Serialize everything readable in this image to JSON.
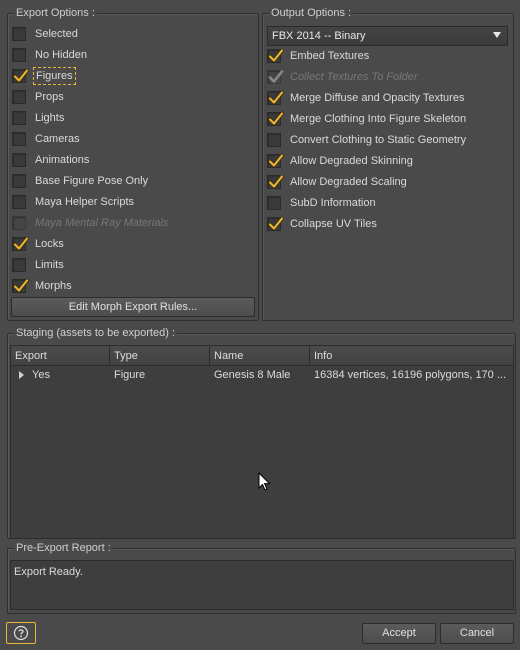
{
  "export_options": {
    "title": "Export Options :",
    "items": [
      {
        "label": "Selected",
        "checked": false,
        "disabled": false
      },
      {
        "label": "No Hidden",
        "checked": false,
        "disabled": false
      },
      {
        "label": "Figures",
        "checked": true,
        "disabled": false
      },
      {
        "label": "Props",
        "checked": false,
        "disabled": false
      },
      {
        "label": "Lights",
        "checked": false,
        "disabled": false
      },
      {
        "label": "Cameras",
        "checked": false,
        "disabled": false
      },
      {
        "label": "Animations",
        "checked": false,
        "disabled": false
      },
      {
        "label": "Base Figure Pose Only",
        "checked": false,
        "disabled": false
      },
      {
        "label": "Maya Helper Scripts",
        "checked": false,
        "disabled": false
      },
      {
        "label": "Maya Mental Ray Materials",
        "checked": false,
        "disabled": true
      },
      {
        "label": "Locks",
        "checked": true,
        "disabled": false
      },
      {
        "label": "Limits",
        "checked": false,
        "disabled": false
      },
      {
        "label": "Morphs",
        "checked": true,
        "disabled": false
      }
    ],
    "edit_morph_button": "Edit Morph Export Rules..."
  },
  "output_options": {
    "title": "Output Options :",
    "format_selected": "FBX 2014 -- Binary",
    "items": [
      {
        "label": "Embed Textures",
        "checked": true,
        "disabled": false
      },
      {
        "label": "Collect Textures To Folder",
        "checked": true,
        "disabled": true
      },
      {
        "label": "Merge Diffuse and Opacity Textures",
        "checked": true,
        "disabled": false
      },
      {
        "label": "Merge Clothing Into Figure Skeleton",
        "checked": true,
        "disabled": false
      },
      {
        "label": "Convert Clothing to Static Geometry",
        "checked": false,
        "disabled": false
      },
      {
        "label": "Allow Degraded Skinning",
        "checked": true,
        "disabled": false
      },
      {
        "label": "Allow Degraded Scaling",
        "checked": true,
        "disabled": false
      },
      {
        "label": "SubD Information",
        "checked": false,
        "disabled": false
      },
      {
        "label": "Collapse UV Tiles",
        "checked": true,
        "disabled": false
      }
    ]
  },
  "staging": {
    "title": "Staging (assets to be exported) :",
    "columns": [
      "Export",
      "Type",
      "Name",
      "Info"
    ],
    "rows": [
      {
        "export": "Yes",
        "type": "Figure",
        "name": "Genesis 8 Male",
        "info": "16384 vertices, 16196 polygons, 170 ..."
      }
    ]
  },
  "report": {
    "title": "Pre-Export Report :",
    "text": "Export Ready."
  },
  "footer": {
    "help_icon": "question-circle-icon",
    "accept_label": "Accept",
    "cancel_label": "Cancel"
  },
  "colors": {
    "background": "#4a4a4a",
    "check_accent": "#e8b43a",
    "focus_outline": "#e8b43a"
  }
}
